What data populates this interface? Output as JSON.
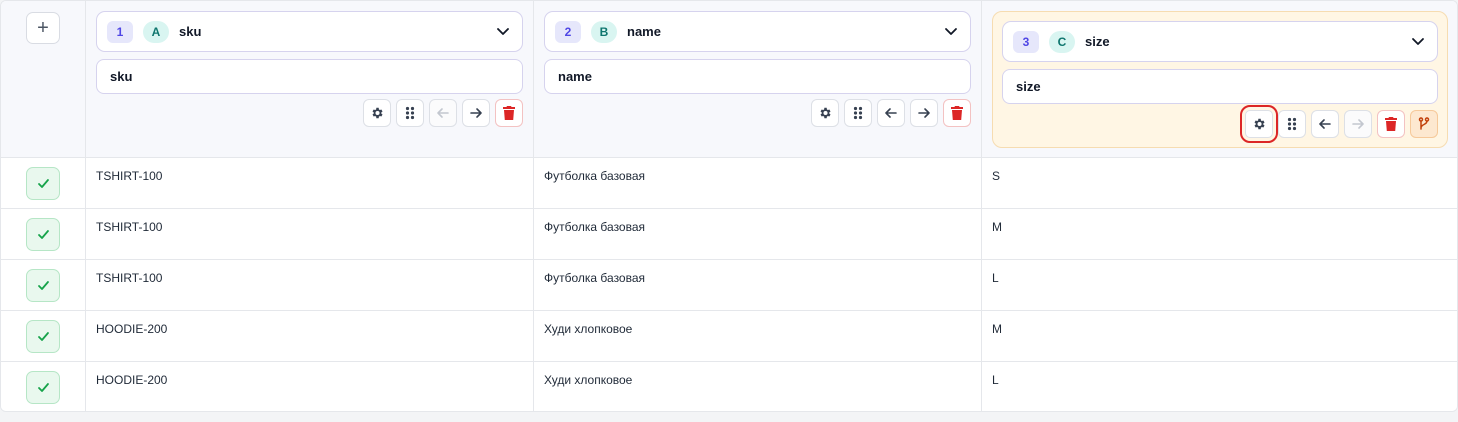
{
  "toolbar": {
    "add_label": "+"
  },
  "columns": [
    {
      "number": "1",
      "letter": "A",
      "field": "sku",
      "name": "sku"
    },
    {
      "number": "2",
      "letter": "B",
      "field": "name",
      "name": "name"
    },
    {
      "number": "3",
      "letter": "C",
      "field": "size",
      "name": "size"
    }
  ],
  "rows": [
    {
      "sku": "TSHIRT-100",
      "name": "Футболка базовая",
      "size": "S"
    },
    {
      "sku": "TSHIRT-100",
      "name": "Футболка базовая",
      "size": "M"
    },
    {
      "sku": "TSHIRT-100",
      "name": "Футболка базовая",
      "size": "L"
    },
    {
      "sku": "HOODIE-200",
      "name": "Худи хлопковое",
      "size": "M"
    },
    {
      "sku": "HOODIE-200",
      "name": "Худи хлопковое",
      "size": "L"
    }
  ],
  "colors": {
    "accent": "#4f46e5",
    "success": "#16a34a",
    "danger": "#dc2626",
    "active_card": "#fff6e4",
    "highlight": "#dc2626"
  },
  "icons": {
    "add": "plus-icon",
    "settings": "gear-icon",
    "move": "drag-handle-icon",
    "left": "arrow-left-icon",
    "right": "arrow-right-icon",
    "delete": "trash-icon",
    "branch": "branch-icon",
    "row_status": "check-icon",
    "dropdown": "chevron-down-icon"
  }
}
